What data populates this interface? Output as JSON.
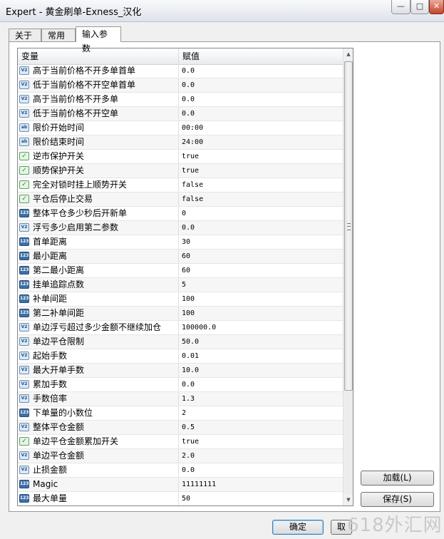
{
  "window": {
    "title": "Expert - 黄金刷单-Exness_汉化",
    "minimize_glyph": "—",
    "maximize_glyph": "□",
    "close_glyph": "✕"
  },
  "tabs": [
    {
      "label": "关于"
    },
    {
      "label": "常用"
    },
    {
      "label": "输入参数"
    }
  ],
  "grid": {
    "col_variable": "变量",
    "col_value": "赋值",
    "rows": [
      {
        "icon": "double",
        "badge": "V2",
        "name": "高于当前价格不开多单首单",
        "value": "0.0"
      },
      {
        "icon": "double",
        "badge": "V2",
        "name": "低于当前价格不开空单首单",
        "value": "0.0"
      },
      {
        "icon": "double",
        "badge": "V2",
        "name": "高于当前价格不开多单",
        "value": "0.0"
      },
      {
        "icon": "double",
        "badge": "V2",
        "name": "低于当前价格不开空单",
        "value": "0.0"
      },
      {
        "icon": "string",
        "badge": "ab",
        "name": "限价开始时间",
        "value": "00:00"
      },
      {
        "icon": "string",
        "badge": "ab",
        "name": "限价结束时间",
        "value": "24:00"
      },
      {
        "icon": "bool",
        "badge": "✓",
        "name": "逆市保护开关",
        "value": "true"
      },
      {
        "icon": "bool",
        "badge": "✓",
        "name": "顺势保护开关",
        "value": "true"
      },
      {
        "icon": "bool",
        "badge": "✓",
        "name": "完全对锁时挂上顺势开关",
        "value": "false"
      },
      {
        "icon": "bool",
        "badge": "✓",
        "name": "平仓后停止交易",
        "value": "false"
      },
      {
        "icon": "int",
        "badge": "123",
        "name": "整体平仓多少秒后开新单",
        "value": "0"
      },
      {
        "icon": "double",
        "badge": "V2",
        "name": "浮亏多少启用第二参数",
        "value": "0.0"
      },
      {
        "icon": "int",
        "badge": "123",
        "name": "首单距离",
        "value": "30"
      },
      {
        "icon": "int",
        "badge": "123",
        "name": "最小距离",
        "value": "60"
      },
      {
        "icon": "int",
        "badge": "123",
        "name": "第二最小距离",
        "value": "60"
      },
      {
        "icon": "int",
        "badge": "123",
        "name": "挂单追踪点数",
        "value": "5"
      },
      {
        "icon": "int",
        "badge": "123",
        "name": "补单间距",
        "value": "100"
      },
      {
        "icon": "int",
        "badge": "123",
        "name": "第二补单间距",
        "value": "100"
      },
      {
        "icon": "double",
        "badge": "V2",
        "name": "单边浮亏超过多少金额不继续加仓",
        "value": "100000.0"
      },
      {
        "icon": "double",
        "badge": "V2",
        "name": "单边平仓限制",
        "value": "50.0"
      },
      {
        "icon": "double",
        "badge": "V2",
        "name": "起始手数",
        "value": "0.01"
      },
      {
        "icon": "double",
        "badge": "V2",
        "name": "最大开单手数",
        "value": "10.0"
      },
      {
        "icon": "double",
        "badge": "V2",
        "name": "累加手数",
        "value": "0.0"
      },
      {
        "icon": "double",
        "badge": "V2",
        "name": "手数倍率",
        "value": "1.3"
      },
      {
        "icon": "int",
        "badge": "123",
        "name": "下单量的小数位",
        "value": "2"
      },
      {
        "icon": "double",
        "badge": "V2",
        "name": "整体平仓金额",
        "value": "0.5"
      },
      {
        "icon": "bool",
        "badge": "✓",
        "name": "单边平仓金额累加开关",
        "value": "true"
      },
      {
        "icon": "double",
        "badge": "V2",
        "name": "单边平仓金额",
        "value": "2.0"
      },
      {
        "icon": "double",
        "badge": "V2",
        "name": "止损金额",
        "value": "0.0"
      },
      {
        "icon": "int",
        "badge": "123",
        "name": "Magic",
        "value": "11111111"
      },
      {
        "icon": "int",
        "badge": "123",
        "name": "最大单量",
        "value": "50"
      }
    ]
  },
  "scrollbar": {
    "up_glyph": "▲",
    "down_glyph": "▼"
  },
  "buttons": {
    "load": "加载(L)",
    "save": "保存(S)",
    "ok": "确定",
    "cancel": "取"
  },
  "watermark": "618外汇网"
}
